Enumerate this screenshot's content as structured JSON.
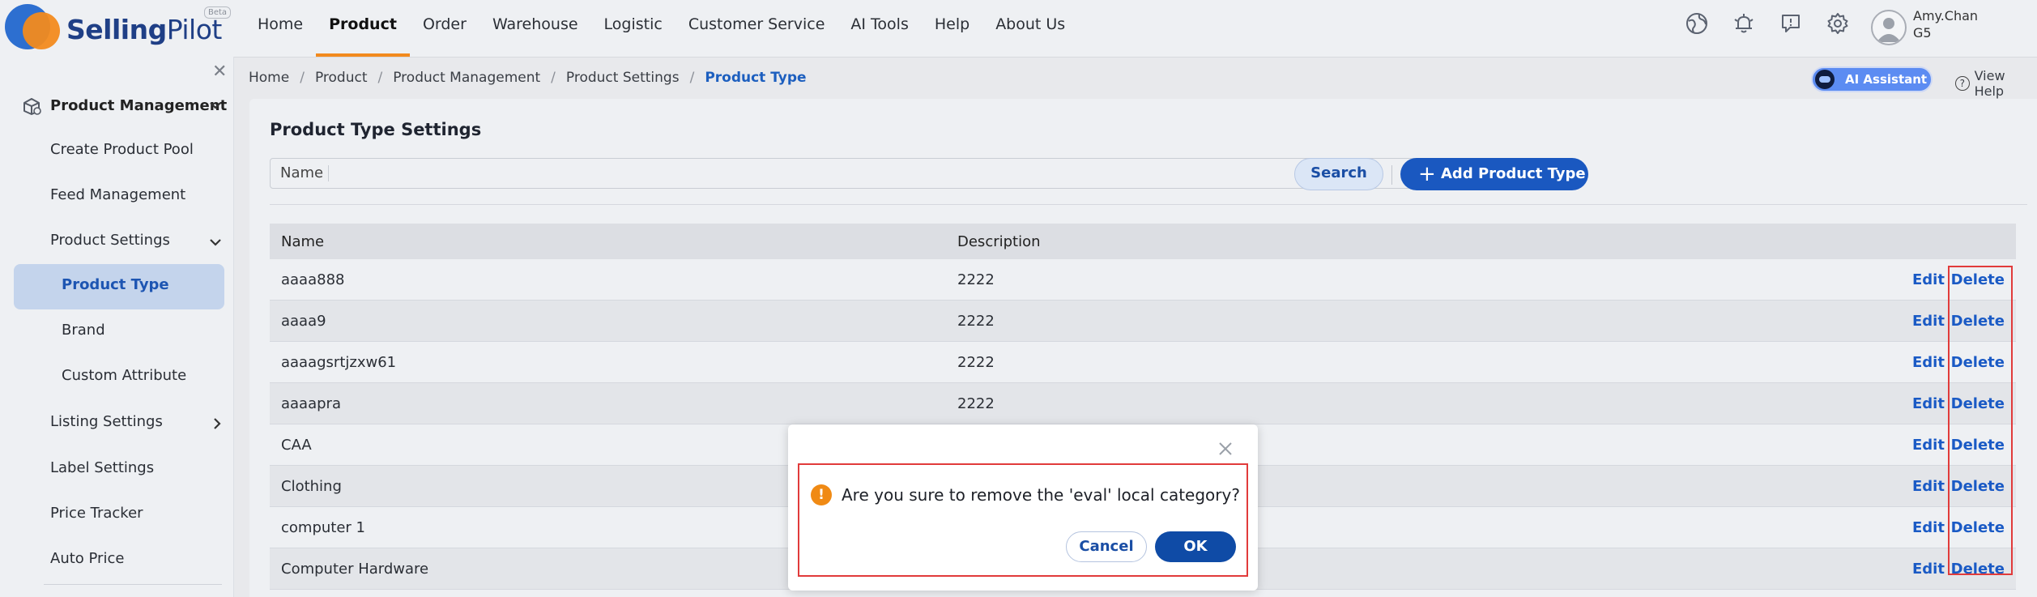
{
  "brand": {
    "name_bold": "Selling",
    "name_rest": "Pilot",
    "badge": "Beta"
  },
  "nav": {
    "items": [
      {
        "label": "Home",
        "active": false
      },
      {
        "label": "Product",
        "active": true
      },
      {
        "label": "Order",
        "active": false
      },
      {
        "label": "Warehouse",
        "active": false
      },
      {
        "label": "Logistic",
        "active": false
      },
      {
        "label": "Customer Service",
        "active": false
      },
      {
        "label": "AI Tools",
        "active": false
      },
      {
        "label": "Help",
        "active": false
      },
      {
        "label": "About Us",
        "active": false
      }
    ]
  },
  "top_icons": [
    "globe-icon",
    "bell-icon",
    "message-icon",
    "gear-icon"
  ],
  "user": {
    "name": "Amy.Chan",
    "level": "G5"
  },
  "sidebar": {
    "close_icon": "close-icon",
    "section": "Product Management",
    "items": [
      {
        "label": "Create Product Pool"
      },
      {
        "label": "Feed Management"
      },
      {
        "label": "Product Settings",
        "expanded": true
      },
      {
        "label": "Product Type",
        "active": true
      },
      {
        "label": "Brand"
      },
      {
        "label": "Custom Attribute"
      },
      {
        "label": "Listing Settings"
      },
      {
        "label": "Label Settings"
      },
      {
        "label": "Price Tracker"
      },
      {
        "label": "Auto Price"
      }
    ]
  },
  "breadcrumb": [
    "Home",
    "Product",
    "Product Management",
    "Product Settings",
    "Product Type"
  ],
  "header_actions": {
    "ai_assistant": "AI Assistant",
    "view_help": "View Help"
  },
  "page": {
    "title": "Product Type Settings",
    "filter_label": "Name",
    "filter_value": "",
    "search_button": "Search",
    "add_button": "Add Product Type"
  },
  "table": {
    "columns": [
      "Name",
      "Description"
    ],
    "action_edit": "Edit",
    "action_delete": "Delete",
    "rows": [
      {
        "name": "aaaa888",
        "description": "2222"
      },
      {
        "name": "aaaa9",
        "description": "2222"
      },
      {
        "name": "aaaagsrtjzxw61",
        "description": "2222"
      },
      {
        "name": "aaaapra",
        "description": "2222"
      },
      {
        "name": "CAA",
        "description": ""
      },
      {
        "name": "Clothing",
        "description": ""
      },
      {
        "name": "computer 1",
        "description": ""
      },
      {
        "name": "Computer Hardware",
        "description": ""
      }
    ]
  },
  "modal": {
    "message": "Are you sure to remove the 'eval' local category?",
    "warning_symbol": "!",
    "cancel": "Cancel",
    "ok": "OK"
  },
  "colors": {
    "accent_orange": "#f28a1e",
    "primary_blue": "#1a58c0",
    "highlight_red": "#e13b3b"
  }
}
